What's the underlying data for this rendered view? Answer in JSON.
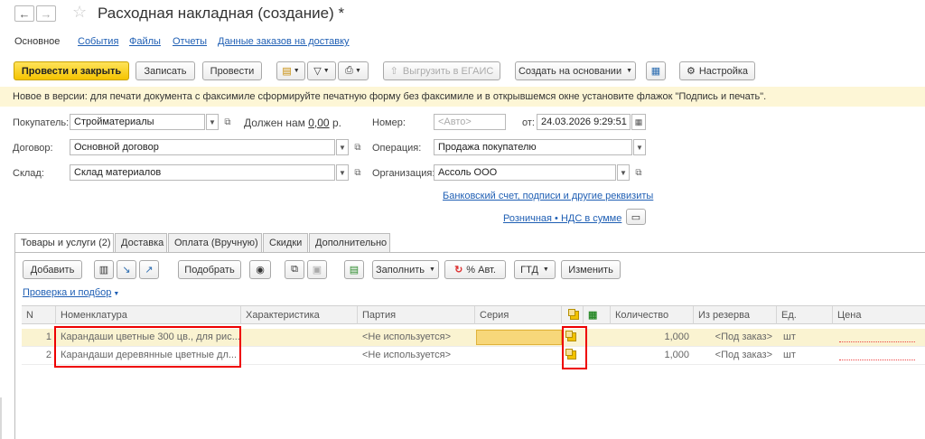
{
  "window": {
    "title": "Расходная накладная (создание) *"
  },
  "nav_tabs": [
    {
      "label": "Основное"
    },
    {
      "label": "События"
    },
    {
      "label": "Файлы"
    },
    {
      "label": "Отчеты"
    },
    {
      "label": "Данные заказов на доставку"
    }
  ],
  "toolbar": {
    "post_close": "Провести и закрыть",
    "save": "Записать",
    "post": "Провести",
    "upload_egais": "Выгрузить в ЕГАИС",
    "create_based": "Создать на основании",
    "settings": "Настройка"
  },
  "notice": "Новое в версии: для печати документа с факсимиле сформируйте печатную форму без факсимиле и в открывшемся окне установите флажок \"Подпись и печать\".",
  "form": {
    "buyer_label": "Покупатель:",
    "buyer_value": "Стройматериалы",
    "owes_prefix": "Должен нам",
    "owes_amount": "0,00",
    "owes_suffix": "р.",
    "number_label": "Номер:",
    "number_placeholder": "<Авто>",
    "date_label": "от:",
    "date_value": "24.03.2026  9:29:51",
    "contract_label": "Договор:",
    "contract_value": "Основной договор",
    "operation_label": "Операция:",
    "operation_value": "Продажа покупателю",
    "warehouse_label": "Склад:",
    "warehouse_value": "Склад материалов",
    "org_label": "Организация:",
    "org_value": "Ассоль ООО",
    "bank_link": "Банковский счет, подписи и другие реквизиты",
    "price_link": "Розничная • НДС в сумме"
  },
  "tabs": [
    {
      "label": "Товары и услуги (2)"
    },
    {
      "label": "Доставка"
    },
    {
      "label": "Оплата (Вручную)"
    },
    {
      "label": "Скидки"
    },
    {
      "label": "Дополнительно"
    }
  ],
  "table_toolbar": {
    "add": "Добавить",
    "pick": "Подобрать",
    "fill": "Заполнить",
    "pct_auto": "% Авт.",
    "gtd": "ГТД",
    "change": "Изменить",
    "check_link": "Проверка и подбор"
  },
  "columns": {
    "n": "N",
    "item": "Номенклатура",
    "char": "Характеристика",
    "batch": "Партия",
    "series": "Серия",
    "qty": "Количество",
    "reserve": "Из резерва",
    "unit": "Ед.",
    "price": "Цена"
  },
  "rows": [
    {
      "n": "1",
      "item": "Карандаши цветные 300 цв., для рис...",
      "batch": "<Не используется>",
      "qty": "1,000",
      "reserve": "<Под заказ>",
      "unit": "шт"
    },
    {
      "n": "2",
      "item": "Карандаши деревянные цветные дл...",
      "batch": "<Не используется>",
      "qty": "1,000",
      "reserve": "<Под заказ>",
      "unit": "шт"
    }
  ]
}
